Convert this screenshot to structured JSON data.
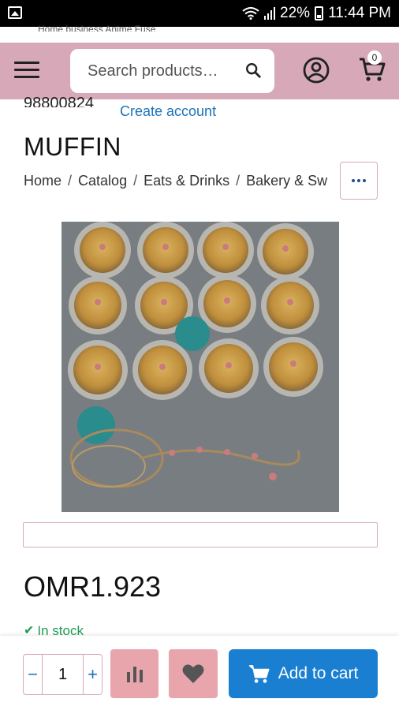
{
  "status_bar": {
    "battery_percent": "22%",
    "time": "11:44 PM",
    "icons": [
      "gallery-icon",
      "wifi-icon",
      "signal-icon",
      "battery-icon"
    ]
  },
  "scrolled_top_text": "Home business Anime Fuse",
  "header": {
    "search_placeholder": "Search products…",
    "cart_count": "0",
    "background_color": "#d7a9b8",
    "icons": [
      "menu-icon",
      "search-icon",
      "user-icon",
      "cart-icon"
    ]
  },
  "account": {
    "phone_partial": "98800824",
    "create_account_label": "Create account"
  },
  "product": {
    "title": "MUFFIN",
    "breadcrumb": [
      "Home",
      "Catalog",
      "Eats & Drinks",
      "Bakery & Sw"
    ],
    "price": "OMR1.923",
    "stock_status": "In stock",
    "stock_color": "#1f9d55"
  },
  "purchase": {
    "quantity": "1",
    "minus_label": "−",
    "plus_label": "+",
    "add_to_cart_label": "Add to cart",
    "accent_color": "#1a7fd1",
    "secondary_button_color": "#e9a5ac"
  }
}
